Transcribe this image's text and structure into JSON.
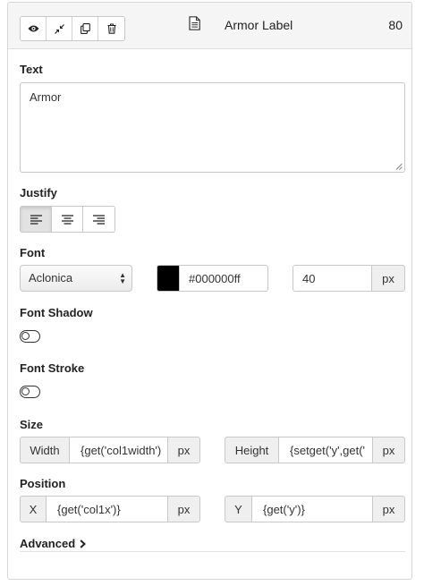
{
  "header": {
    "title": "Armor Label",
    "number": "80",
    "tools": [
      {
        "icon": "eye-icon"
      },
      {
        "icon": "collapse-icon"
      },
      {
        "icon": "duplicate-icon"
      },
      {
        "icon": "trash-icon"
      }
    ],
    "doc_icon": "document-icon"
  },
  "text_section": {
    "label": "Text",
    "value": "Armor"
  },
  "justify": {
    "label": "Justify",
    "options": [
      "left",
      "center",
      "right"
    ],
    "selected": "left"
  },
  "font": {
    "label": "Font",
    "family": "Aclonica",
    "color_value": "#000000ff",
    "swatch_color": "#000000",
    "size_value": "40",
    "size_unit": "px"
  },
  "font_shadow": {
    "label": "Font Shadow",
    "enabled": false
  },
  "font_stroke": {
    "label": "Font Stroke",
    "enabled": false
  },
  "size": {
    "label": "Size",
    "width_label": "Width",
    "width_value": "{get('col1width')",
    "width_unit": "px",
    "height_label": "Height",
    "height_value": "{setget('y',get('",
    "height_unit": "px"
  },
  "position": {
    "label": "Position",
    "x_label": "X",
    "x_value": "{get('col1x')}",
    "x_unit": "px",
    "y_label": "Y",
    "y_value": "{get('y')}",
    "y_unit": "px"
  },
  "advanced": {
    "label": "Advanced"
  }
}
